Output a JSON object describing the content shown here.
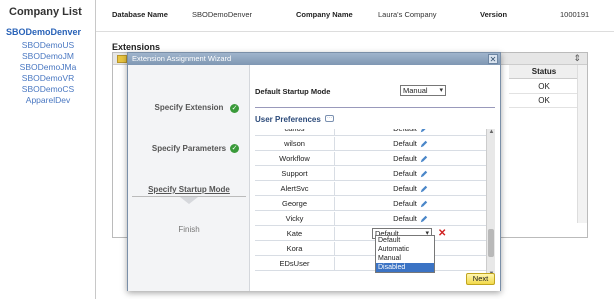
{
  "sidebar": {
    "title": "Company List",
    "active": "SBODemoDenver",
    "items": [
      "SBODemoUS",
      "SBODemoJM",
      "SBODemoJMa",
      "SBODemoVR",
      "SBODemoCS",
      "ApparelDev"
    ]
  },
  "header": {
    "db_label": "Database Name",
    "db_value": "SBODemoDenver",
    "company_label": "Company Name",
    "company_value": "Laura's Company",
    "version_label": "Version",
    "version_value": "1000191"
  },
  "extensions": {
    "title": "Extensions",
    "status_header": "Status",
    "rows": [
      "OK",
      "OK"
    ]
  },
  "wizard": {
    "title": "Extension Assignment Wizard",
    "steps": [
      {
        "label": "Specify Extension",
        "state": "done"
      },
      {
        "label": "Specify Parameters",
        "state": "done"
      },
      {
        "label": "Specify Startup Mode",
        "state": "current"
      },
      {
        "label": "Finish",
        "state": "pending"
      }
    ],
    "startup_mode_label": "Default Startup Mode",
    "startup_mode_value": "Manual",
    "user_prefs_title": "User Preferences",
    "users": [
      {
        "name": "carlos",
        "value": "Default"
      },
      {
        "name": "wilson",
        "value": "Default"
      },
      {
        "name": "Workflow",
        "value": "Default"
      },
      {
        "name": "Support",
        "value": "Default"
      },
      {
        "name": "AlertSvc",
        "value": "Default"
      },
      {
        "name": "George",
        "value": "Default"
      },
      {
        "name": "Vicky",
        "value": "Default"
      },
      {
        "name": "Kate",
        "value": "Default"
      },
      {
        "name": "Kora",
        "value": ""
      },
      {
        "name": "EDsUser",
        "value": ""
      }
    ],
    "dropdown_options": [
      "Default",
      "Automatic",
      "Manual",
      "Disabled"
    ],
    "dropdown_highlighted": "Disabled",
    "next_label": "Next"
  },
  "colors": {
    "link": "#4a78c2",
    "title_bar": "#8ea5c0",
    "check": "#3a9a3a",
    "highlight": "#3b73c4",
    "next_button": "#f2d94a"
  }
}
